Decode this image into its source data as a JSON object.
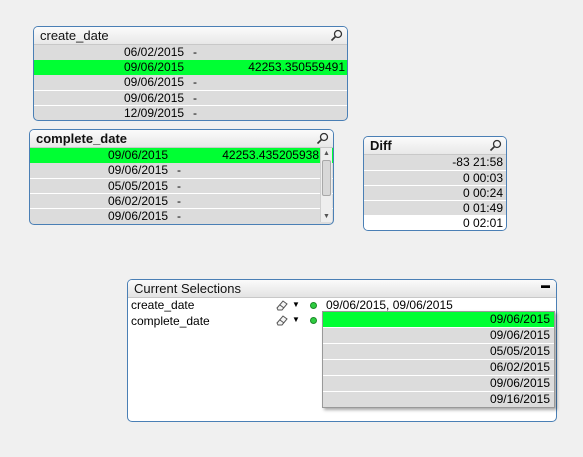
{
  "create_date_box": {
    "title": "create_date",
    "rows": [
      {
        "date": "06/02/2015",
        "value": "-",
        "selected": false
      },
      {
        "date": "09/06/2015",
        "value": "42253.350559491",
        "selected": true
      },
      {
        "date": "09/06/2015",
        "value": "-",
        "selected": false
      },
      {
        "date": "09/06/2015",
        "value": "-",
        "selected": false
      },
      {
        "date": "12/09/2015",
        "value": "-",
        "selected": false
      }
    ]
  },
  "complete_date_box": {
    "title": "complete_date",
    "rows": [
      {
        "date": "09/06/2015",
        "value": "42253.435205938",
        "selected": true
      },
      {
        "date": "09/06/2015",
        "value": "-",
        "selected": false
      },
      {
        "date": "05/05/2015",
        "value": "-",
        "selected": false
      },
      {
        "date": "06/02/2015",
        "value": "-",
        "selected": false
      },
      {
        "date": "09/06/2015",
        "value": "-",
        "selected": false
      }
    ]
  },
  "diff_box": {
    "title": "Diff",
    "rows": [
      "-83 21:58",
      "0 00:03",
      "0 00:24",
      "0 01:49",
      "0 02:01"
    ]
  },
  "current_selections": {
    "title": "Current Selections",
    "minimize_label": "▬",
    "fields": [
      {
        "name": "create_date",
        "values": "09/06/2015, 09/06/2015"
      },
      {
        "name": "complete_date",
        "values": ""
      }
    ],
    "dropdown": [
      {
        "label": "09/06/2015",
        "selected": true
      },
      {
        "label": "09/06/2015",
        "selected": false
      },
      {
        "label": "05/05/2015",
        "selected": false
      },
      {
        "label": "06/02/2015",
        "selected": false
      },
      {
        "label": "09/06/2015",
        "selected": false
      },
      {
        "label": "09/16/2015",
        "selected": false
      }
    ]
  },
  "colors": {
    "selected": "#00ff33",
    "border": "#4a7fb5",
    "list_bg": "#dcdcdc",
    "page_bg": "#f0f0f0"
  }
}
